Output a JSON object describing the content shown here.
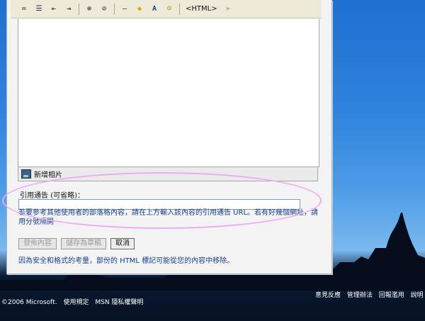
{
  "toolbar": {
    "buttons": [
      {
        "name": "numbered-list-icon",
        "glyph": "≔"
      },
      {
        "name": "bullet-list-icon",
        "glyph": "☰"
      },
      {
        "name": "outdent-icon",
        "glyph": "⇤"
      },
      {
        "name": "indent-icon",
        "glyph": "⇥"
      },
      {
        "name": "link-icon",
        "glyph": "⊗"
      },
      {
        "name": "unlink-icon",
        "glyph": "⊘"
      },
      {
        "name": "horizontal-rule-icon",
        "glyph": "—"
      },
      {
        "name": "highlight-color-icon",
        "glyph": "◆"
      },
      {
        "name": "font-color-icon",
        "glyph": "A"
      },
      {
        "name": "emoticon-icon",
        "glyph": "☺"
      }
    ],
    "html_label": "<HTML>",
    "more_glyph": "»"
  },
  "photo_bar": {
    "label": "新增相片"
  },
  "trackback": {
    "label": "引用通告 (可省略)：",
    "value": "",
    "hint": "若要參考其他使用者的部落格內容，請在上方輸入該內容的引用通告 URL。若有好幾個網址，請用分號隔開"
  },
  "buttons": {
    "publish": "發佈內容",
    "save_draft": "儲存為草稿",
    "cancel": "取消"
  },
  "security_note": "因為安全和格式的考量，部份的 HTML 標記可能從您的內容中移除。",
  "footer": {
    "copyright": "©2006 Microsoft.",
    "terms": "使用規定",
    "privacy": "MSN 隱私權聲明",
    "feedback": "意見反應",
    "admin_policy": "管理辦法",
    "report_abuse": "回報濫用",
    "help": "說明"
  }
}
